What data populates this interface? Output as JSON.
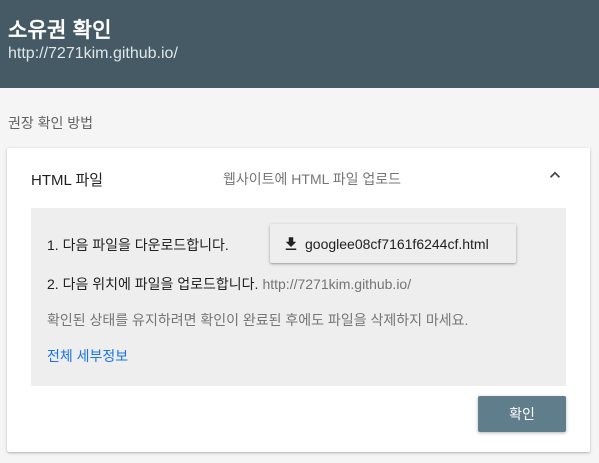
{
  "header": {
    "title": "소유권 확인",
    "subtitle": "http://7271kim.github.io/",
    "background": "#455a64"
  },
  "section": {
    "label": "권장 확인 방법"
  },
  "method": {
    "title": "HTML 파일",
    "description": "웹사이트에 HTML 파일 업로드",
    "expanded": true,
    "toggle_icon": "chevron-up-icon",
    "steps": {
      "step1_text": "1. 다음 파일을 다운로드합니다.",
      "download_icon": "download-icon",
      "download_filename": "googlee08cf7161f6244cf.html",
      "step2_text": "2. 다음 위치에 파일을 업로드합니다.",
      "step2_url": "http://7271kim.github.io/",
      "note": "확인된 상태를 유지하려면 확인이 완료된 후에도 파일을 삭제하지 마세요.",
      "details_link": "전체 세부정보"
    }
  },
  "actions": {
    "confirm_label": "확인",
    "confirm_color": "#607d8b"
  },
  "colors": {
    "link": "#1a73e8",
    "panel": "#eeeeee",
    "page": "#f5f5f5"
  }
}
